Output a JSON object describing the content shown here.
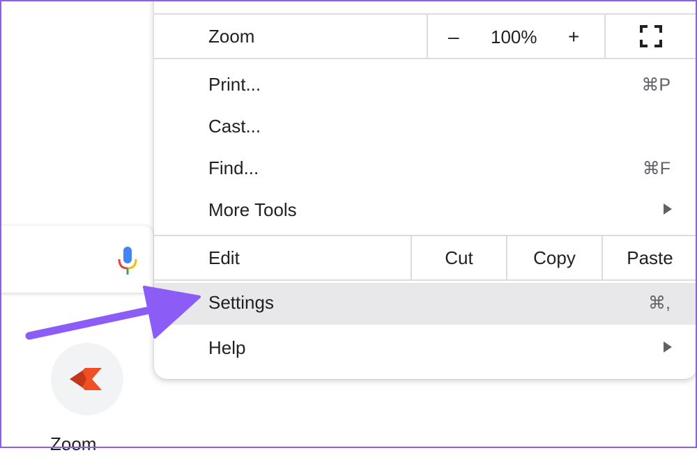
{
  "background": {
    "shortcut_label": "Zoom"
  },
  "menu": {
    "zoom": {
      "label": "Zoom",
      "minus": "–",
      "value": "100%",
      "plus": "+"
    },
    "print": {
      "label": "Print...",
      "shortcut": "⌘P"
    },
    "cast": {
      "label": "Cast..."
    },
    "find": {
      "label": "Find...",
      "shortcut": "⌘F"
    },
    "more_tools": {
      "label": "More Tools"
    },
    "edit": {
      "label": "Edit",
      "cut": "Cut",
      "copy": "Copy",
      "paste": "Paste"
    },
    "settings": {
      "label": "Settings",
      "shortcut": "⌘,"
    },
    "help": {
      "label": "Help"
    }
  },
  "colors": {
    "annotation_arrow": "#8b5cf6",
    "highlight": "#e8e8ea",
    "divider": "#dadce0"
  },
  "icons": [
    "microphone-icon",
    "fullscreen-icon",
    "submenu-arrow-icon",
    "shortcut-logo-icon"
  ]
}
